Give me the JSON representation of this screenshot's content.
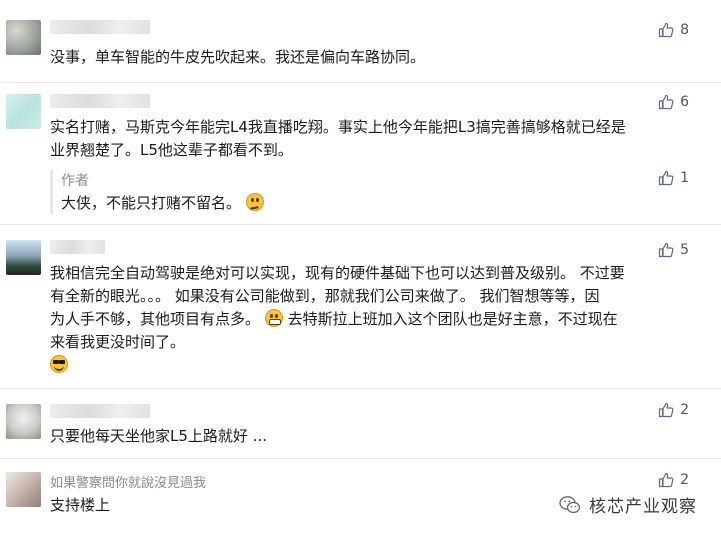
{
  "comments": [
    {
      "likes": "8",
      "text": "没事，单车智能的牛皮先吹起来。我还是偏向车路协同。"
    },
    {
      "likes": "6",
      "text_lines": [
        "实名打赌，马斯克今年能完L4我直播吃翔。事实上他今年能把L3搞完善搞够格就已经是",
        "业界翘楚了。L5他这辈子都看不到。"
      ],
      "reply": {
        "author": "作者",
        "text": "大侠，不能只打赌不留名。",
        "emoji": "thinking-emoji",
        "likes": "1"
      }
    },
    {
      "likes": "5",
      "text_lines": [
        "我相信完全自动驾驶是绝对可以实现，现有的硬件基础下也可以达到普及级别。 不过要",
        "有全新的眼光。。。 如果没有公司能做到，那就我们公司来做了。 我们智想等等，因",
        "为人手不够，其他项目有点多。",
        " 去特斯拉上班加入这个团队也是好主意，不过现在",
        "来看我更没时间了。"
      ],
      "emojis": [
        "grin-emoji",
        "sunglasses-emoji"
      ]
    },
    {
      "likes": "2",
      "text": "只要他每天坐他家L5上路就好 ..."
    },
    {
      "likes": "2",
      "nickname": "如果警察問你就說沒見過我",
      "text": "支持楼上"
    }
  ],
  "watermark": {
    "text": "核芯产业观察",
    "icon": "wechat-icon"
  },
  "colors": {
    "text": "#1c1c1c",
    "muted": "#8c8c8c",
    "like_icon": "#5b6b8c",
    "divider": "#e9e9e9"
  }
}
